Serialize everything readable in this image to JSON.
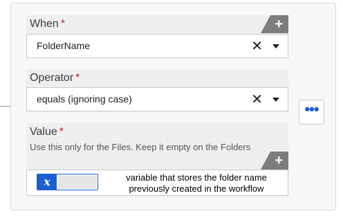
{
  "condition": {
    "when": {
      "label": "When",
      "required_mark": "*",
      "value": "FolderName",
      "clear_glyph": "✕",
      "add_glyph": "+"
    },
    "operator": {
      "label": "Operator",
      "required_mark": "*",
      "value": "equals (ignoring case)",
      "clear_glyph": "✕"
    },
    "value": {
      "label": "Value",
      "required_mark": "*",
      "hint": "Use this only for the Files. Keep it empty on the Folders",
      "add_glyph": "+",
      "token_badge": "x",
      "annotation": "variable that stores the folder name previously created in the workflow"
    },
    "more_button": "•••"
  },
  "colors": {
    "accent": "#1b5fcf",
    "required": "#c4262e",
    "tab": "#7d7d7d"
  },
  "icons": {
    "clear": "close-icon",
    "dropdown": "chevron-down-icon",
    "add": "plus-icon",
    "variable": "variable-icon",
    "more": "ellipsis-icon"
  }
}
